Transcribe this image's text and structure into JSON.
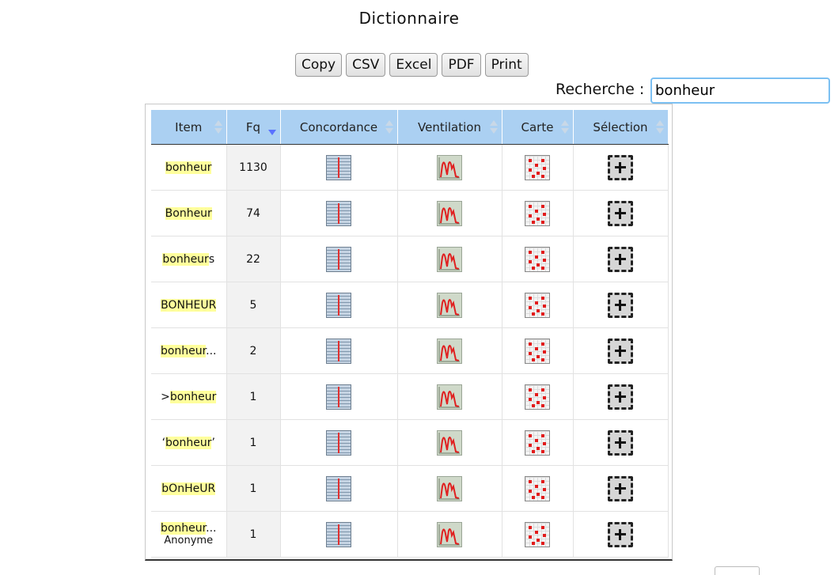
{
  "page": {
    "title": "Dictionnaire"
  },
  "toolbar": {
    "buttons": [
      "Copy",
      "CSV",
      "Excel",
      "PDF",
      "Print"
    ]
  },
  "search": {
    "label": "Recherche :",
    "value": "bonheur"
  },
  "table": {
    "headers": [
      "Item",
      "Fq",
      "Concordance",
      "Ventilation",
      "Carte",
      "Sélection"
    ],
    "sorted_column": "Fq",
    "sort_direction": "descending",
    "rows": [
      {
        "pre": "",
        "hl": "bonheur",
        "post": "",
        "sub": "",
        "fq": "1130"
      },
      {
        "pre": "",
        "hl": "Bonheur",
        "post": "",
        "sub": "",
        "fq": "74"
      },
      {
        "pre": "",
        "hl": "bonheur",
        "post": "s",
        "sub": "",
        "fq": "22"
      },
      {
        "pre": "",
        "hl": "BONHEUR",
        "post": "",
        "sub": "",
        "fq": "5"
      },
      {
        "pre": "",
        "hl": "bonheur",
        "post": "...",
        "sub": "",
        "fq": "2"
      },
      {
        "pre": ">",
        "hl": "bonheur",
        "post": "",
        "sub": "",
        "fq": "1"
      },
      {
        "pre": "‘",
        "hl": "bonheur",
        "post": "’",
        "sub": "",
        "fq": "1"
      },
      {
        "pre": "",
        "hl": "bOnHeUR",
        "post": "",
        "sub": "",
        "fq": "1"
      },
      {
        "pre": "",
        "hl": "bonheur",
        "post": "...",
        "sub": "Anonyme",
        "fq": "1"
      }
    ],
    "icons": {
      "concordance": "concordance-icon",
      "ventilation": "ventilation-chart-icon",
      "carte": "map-grid-icon",
      "selection": "select-plus-icon"
    }
  },
  "colors": {
    "header_bg": "#abd0f2",
    "highlight": "#ffff9c",
    "search_border": "#7cc0f2",
    "icon_red": "#e21b1b"
  }
}
